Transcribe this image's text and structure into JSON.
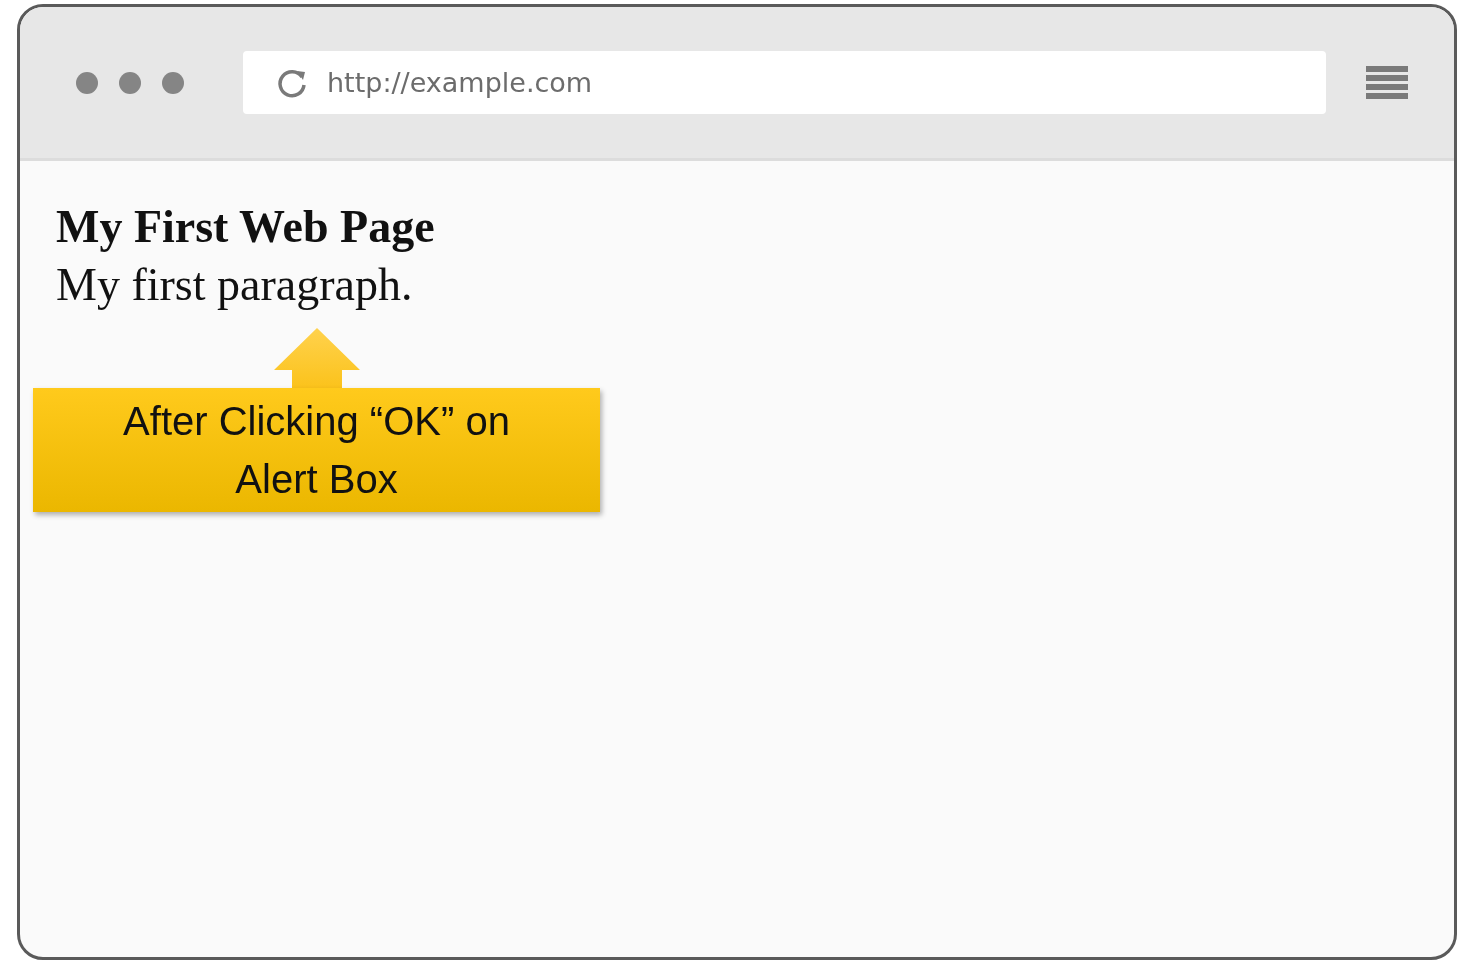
{
  "browser": {
    "url": "http://example.com"
  },
  "page": {
    "heading": "My First Web Page",
    "paragraph": "My first paragraph."
  },
  "callout": {
    "text": "After Clicking “OK” on Alert Box"
  }
}
